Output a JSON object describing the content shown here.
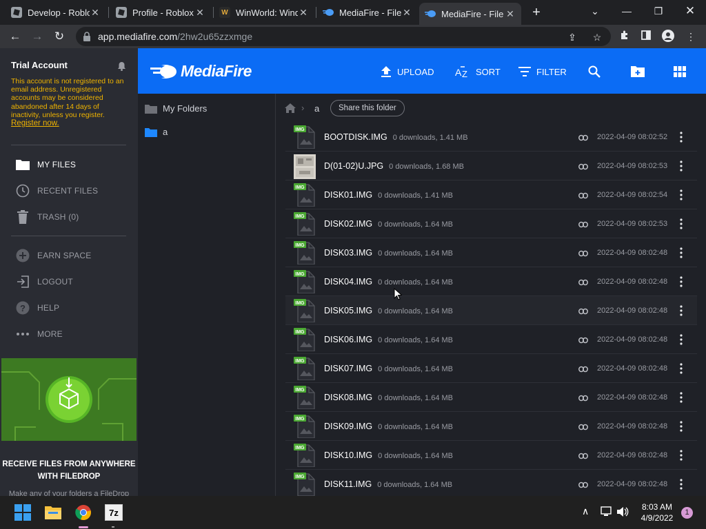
{
  "browser": {
    "tabs": [
      {
        "title": "Develop - Roblox",
        "favicon": "roblox-icon",
        "active": false
      },
      {
        "title": "Profile - Roblox",
        "favicon": "roblox-icon",
        "active": false
      },
      {
        "title": "WinWorld: Windows",
        "favicon": "winworld-icon",
        "active": false
      },
      {
        "title": "MediaFire - File",
        "favicon": "mediafire-icon",
        "active": false
      },
      {
        "title": "MediaFire - File",
        "favicon": "mediafire-icon",
        "active": true
      }
    ],
    "url_host": "app.mediafire.com",
    "url_path": "/2hw2u65zzxmge"
  },
  "sidebar": {
    "account_title": "Trial Account",
    "warning": "This account is not registered to an email address. Unregistered accounts may be considered abandoned after 14 days of inactivity, unless you register.",
    "register_link": "Register now.",
    "nav": [
      {
        "label": "MY FILES",
        "icon": "folder-icon",
        "active": true
      },
      {
        "label": "RECENT FILES",
        "icon": "clock-icon",
        "active": false
      },
      {
        "label": "TRASH (0)",
        "icon": "trash-icon",
        "active": false
      }
    ],
    "nav2": [
      {
        "label": "EARN SPACE",
        "icon": "plus-circle-icon"
      },
      {
        "label": "LOGOUT",
        "icon": "logout-icon"
      },
      {
        "label": "HELP",
        "icon": "help-icon"
      },
      {
        "label": "MORE",
        "icon": "more-icon"
      }
    ],
    "promo_title": "RECEIVE FILES FROM ANYWHERE WITH FILEDROP",
    "promo_sub": "Make any of your folders a FileDrop"
  },
  "header": {
    "logo": "MediaFire",
    "upload": "UPLOAD",
    "sort": "SORT",
    "filter": "FILTER"
  },
  "tree": {
    "root": "My Folders",
    "folder": "a"
  },
  "breadcrumb": {
    "current": "a",
    "share": "Share this folder"
  },
  "files": [
    {
      "name": "BOOTDISK.IMG",
      "meta": "0 downloads, 1.41 MB",
      "date": "2022-04-09 08:02:52",
      "type": "IMG"
    },
    {
      "name": "D(01-02)U.JPG",
      "meta": "0 downloads, 1.68 MB",
      "date": "2022-04-09 08:02:53",
      "type": "JPG"
    },
    {
      "name": "DISK01.IMG",
      "meta": "0 downloads, 1.41 MB",
      "date": "2022-04-09 08:02:54",
      "type": "IMG"
    },
    {
      "name": "DISK02.IMG",
      "meta": "0 downloads, 1.64 MB",
      "date": "2022-04-09 08:02:53",
      "type": "IMG"
    },
    {
      "name": "DISK03.IMG",
      "meta": "0 downloads, 1.64 MB",
      "date": "2022-04-09 08:02:48",
      "type": "IMG"
    },
    {
      "name": "DISK04.IMG",
      "meta": "0 downloads, 1.64 MB",
      "date": "2022-04-09 08:02:48",
      "type": "IMG"
    },
    {
      "name": "DISK05.IMG",
      "meta": "0 downloads, 1.64 MB",
      "date": "2022-04-09 08:02:48",
      "type": "IMG"
    },
    {
      "name": "DISK06.IMG",
      "meta": "0 downloads, 1.64 MB",
      "date": "2022-04-09 08:02:48",
      "type": "IMG"
    },
    {
      "name": "DISK07.IMG",
      "meta": "0 downloads, 1.64 MB",
      "date": "2022-04-09 08:02:48",
      "type": "IMG"
    },
    {
      "name": "DISK08.IMG",
      "meta": "0 downloads, 1.64 MB",
      "date": "2022-04-09 08:02:48",
      "type": "IMG"
    },
    {
      "name": "DISK09.IMG",
      "meta": "0 downloads, 1.64 MB",
      "date": "2022-04-09 08:02:48",
      "type": "IMG"
    },
    {
      "name": "DISK10.IMG",
      "meta": "0 downloads, 1.64 MB",
      "date": "2022-04-09 08:02:48",
      "type": "IMG"
    },
    {
      "name": "DISK11.IMG",
      "meta": "0 downloads, 1.64 MB",
      "date": "2022-04-09 08:02:48",
      "type": "IMG"
    }
  ],
  "badge_label": "IMG",
  "taskbar": {
    "time": "8:03 AM",
    "date": "4/9/2022",
    "notification_count": "1",
    "app_7z": "7z"
  }
}
